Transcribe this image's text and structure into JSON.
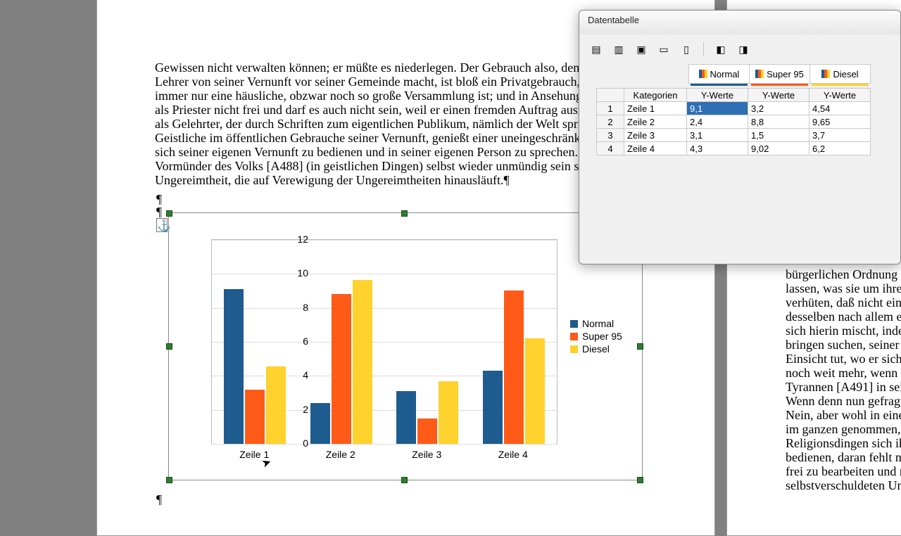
{
  "dialog": {
    "title": "Datentabelle",
    "series_headers": [
      "Normal",
      "Super 95",
      "Diesel"
    ],
    "col_headers": [
      "Kategorien",
      "Y-Werte",
      "Y-Werte",
      "Y-Werte"
    ],
    "rows": [
      {
        "n": "1",
        "cat": "Zeile 1",
        "v": [
          "9,1",
          "3,2",
          "4,54"
        ]
      },
      {
        "n": "2",
        "cat": "Zeile 2",
        "v": [
          "2,4",
          "8,8",
          "9,65"
        ]
      },
      {
        "n": "3",
        "cat": "Zeile 3",
        "v": [
          "3,1",
          "1,5",
          "3,7"
        ]
      },
      {
        "n": "4",
        "cat": "Zeile 4",
        "v": [
          "4,3",
          "9,02",
          "6,2"
        ]
      }
    ],
    "selected_cell": "9,1"
  },
  "document": {
    "para1": "Gewissen nicht verwalten können; er müßte es niederlegen. Der Gebrauch also, den e\nLehrer von seiner Vernunft vor seiner Gemeinde macht, ist bloß ein Privatgebrauch, w\nimmer nur eine häusliche, obzwar noch so große Versammlung ist; und in Ansehung d\nals Priester nicht frei und darf es auch nicht sein, weil er einen fremden Auftrag ausric\nals Gelehrter, der durch Schriften zum eigentlichen Publikum, nämlich der Welt spric\nGeistliche im öffentlichen Gebrauche seiner Vernunft, genießt einer uneingeschränkte\nsich seiner eigenen Vernunft zu bedienen und in seiner eigenen Person zu sprechen. D\nVormünder des Volks [A488] (in geistlichen Dingen) selbst wieder unmündig sein sol\nUngereimtheit, die auf Verewigung der Ungereimtheiten hinausläuft.¶",
    "para2_right": "bürgerlichen Ordnung z\nlassen, was sie um ihres\nverhüten, daß nicht eine\ndesselben nach allem ese\nsich hierin mischt, inden\nbringen suchen, seiner E\nEinsicht tut, wo er sich l\nnoch weit mehr, wenn e\nTyrannen [A491] in sein\n¶\nWenn denn nun gefragt \nNein, aber wohl in einen\nim ganzen genommen, d\nReligionsdingen sich ihr\nbedienen, daran fehlt no\nfrei zu bearbeiten und n\nselbstverschuldeten Unr"
  },
  "chart_data": {
    "type": "bar",
    "categories": [
      "Zeile 1",
      "Zeile 2",
      "Zeile 3",
      "Zeile 4"
    ],
    "series": [
      {
        "name": "Normal",
        "color": "#1e5b8e",
        "values": [
          9.1,
          2.4,
          3.1,
          4.3
        ]
      },
      {
        "name": "Super 95",
        "color": "#ff5a17",
        "values": [
          3.2,
          8.8,
          1.5,
          9.02
        ]
      },
      {
        "name": "Diesel",
        "color": "#ffd22e",
        "values": [
          4.54,
          9.65,
          3.7,
          6.2
        ]
      }
    ],
    "ylim": [
      0,
      12
    ],
    "yticks": [
      0,
      2,
      4,
      6,
      8,
      10,
      12
    ],
    "xlabel": "",
    "ylabel": "",
    "title": ""
  },
  "icons": {
    "insert_row": "▤",
    "insert_col": "▥",
    "insert_text_col": "▣",
    "delete_row": "▭",
    "delete_col": "▯",
    "swap1": "◧",
    "swap2": "◨"
  }
}
